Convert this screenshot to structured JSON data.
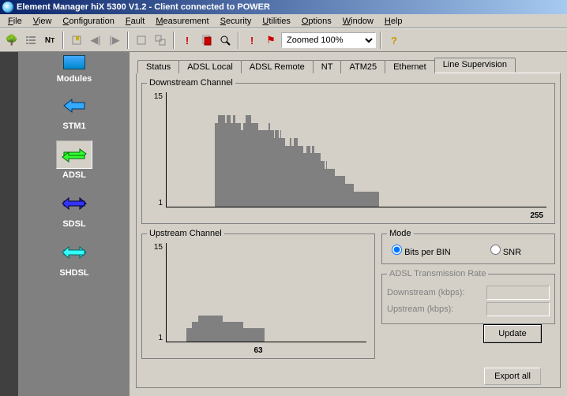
{
  "window": {
    "title": "Element Manager hiX 5300 V1.2 - Client connected to POWER"
  },
  "menu": [
    "File",
    "View",
    "Configuration",
    "Fault",
    "Measurement",
    "Security",
    "Utilities",
    "Options",
    "Window",
    "Help"
  ],
  "toolbar": {
    "zoom": "Zoomed 100%"
  },
  "sidebar": {
    "heading": "Modules",
    "items": [
      {
        "label": "STM1",
        "icon": "stm1-icon",
        "selected": false
      },
      {
        "label": "ADSL",
        "icon": "adsl-icon",
        "selected": true
      },
      {
        "label": "SDSL",
        "icon": "sdsl-icon",
        "selected": false
      },
      {
        "label": "SHDSL",
        "icon": "shdsl-icon",
        "selected": false
      }
    ]
  },
  "tabs": [
    "Status",
    "ADSL Local",
    "ADSL Remote",
    "NT",
    "ATM25",
    "Ethernet",
    "Line Supervision"
  ],
  "active_tab": "Line Supervision",
  "downstream": {
    "title": "Downstream Channel",
    "y_top": "15",
    "y_bot": "1",
    "x_max": "255"
  },
  "upstream": {
    "title": "Upstream Channel",
    "y_top": "15",
    "y_bot": "1",
    "x_max": "63"
  },
  "mode": {
    "title": "Mode",
    "opt1": "Bits per BIN",
    "opt2": "SNR",
    "selected": "Bits per BIN"
  },
  "rate": {
    "title": "ADSL Transmission Rate",
    "down_label": "Downstream (kbps):",
    "up_label": "Upstream (kbps):",
    "down_value": "",
    "up_value": ""
  },
  "buttons": {
    "update": "Update",
    "export": "Export all"
  },
  "chart_data": [
    {
      "type": "bar",
      "name": "Downstream Channel",
      "xlabel": "",
      "ylabel": "",
      "ylim": [
        1,
        15
      ],
      "xlim": [
        1,
        255
      ],
      "x_start": 33,
      "values": [
        11,
        11,
        12,
        12,
        12,
        12,
        12,
        12,
        11,
        12,
        12,
        12,
        11,
        11,
        12,
        12,
        11,
        11,
        11,
        11,
        10,
        10,
        11,
        11,
        12,
        12,
        12,
        12,
        11,
        11,
        11,
        11,
        11,
        11,
        10,
        10,
        10,
        10,
        10,
        10,
        10,
        10,
        11,
        10,
        10,
        10,
        9,
        10,
        10,
        10,
        9,
        10,
        9,
        9,
        9,
        8,
        8,
        8,
        8,
        9,
        8,
        8,
        9,
        9,
        9,
        8,
        8,
        8,
        8,
        7,
        7,
        7,
        8,
        8,
        8,
        7,
        8,
        8,
        7,
        7,
        7,
        7,
        7,
        6,
        6,
        6,
        5,
        6,
        5,
        5,
        5,
        5,
        5,
        5,
        4,
        4,
        4,
        4,
        4,
        4,
        4,
        4,
        3,
        3,
        3,
        3,
        3,
        3,
        3,
        2,
        2,
        2,
        2,
        2,
        2,
        2,
        2,
        2,
        2,
        2,
        2,
        2,
        2,
        2,
        2,
        2,
        2,
        2,
        2
      ]
    },
    {
      "type": "bar",
      "name": "Upstream Channel",
      "xlabel": "",
      "ylabel": "",
      "ylim": [
        1,
        15
      ],
      "xlim": [
        1,
        63
      ],
      "x_start": 7,
      "values": [
        2,
        2,
        3,
        3,
        4,
        4,
        4,
        4,
        4,
        4,
        4,
        4,
        3,
        3,
        3,
        3,
        3,
        3,
        3,
        2,
        2,
        2,
        2,
        2,
        2,
        2
      ]
    }
  ]
}
